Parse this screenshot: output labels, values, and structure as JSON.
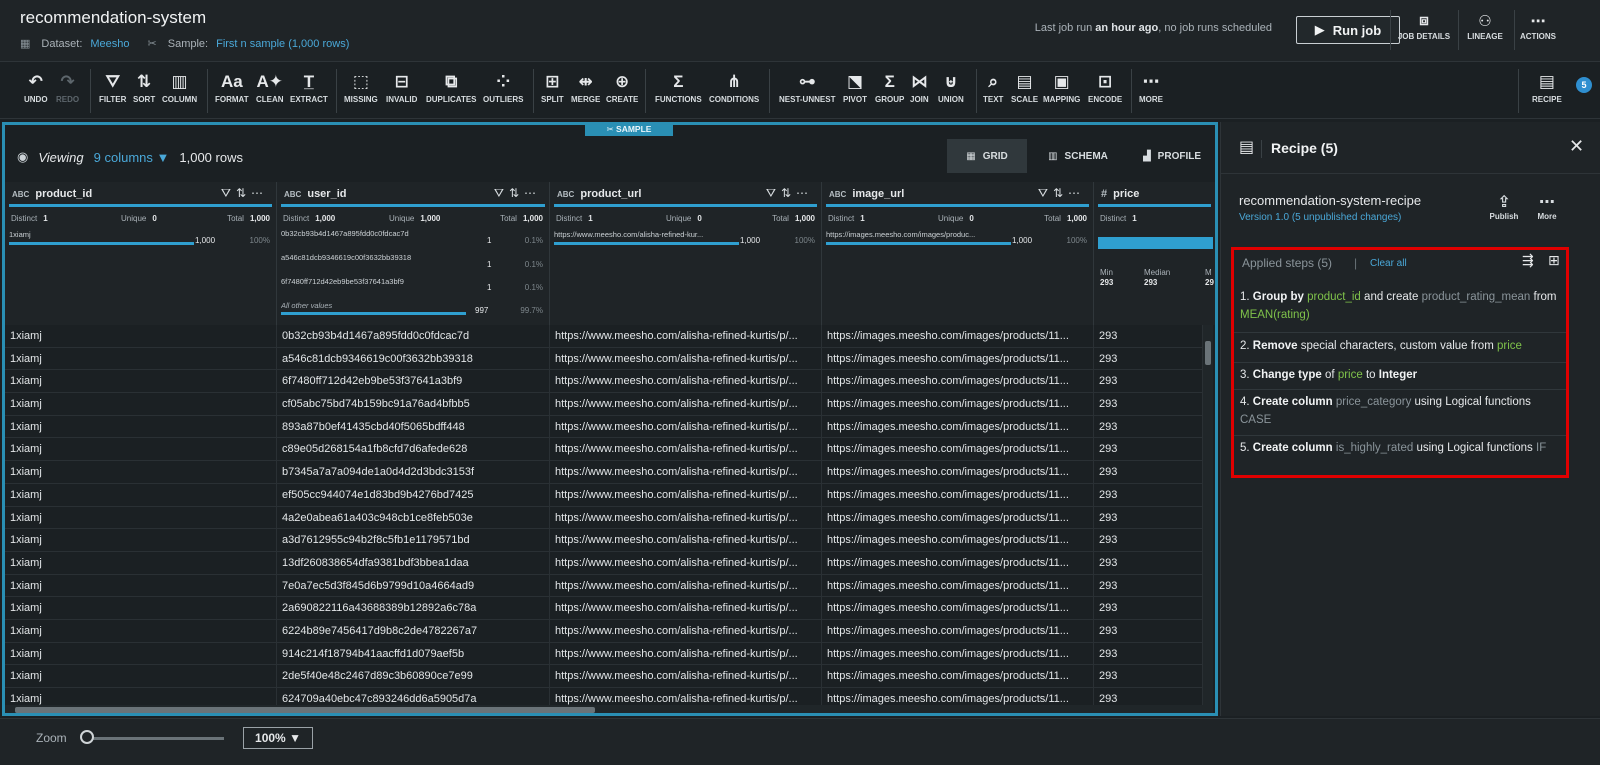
{
  "header": {
    "title": "recommendation-system",
    "dataset_label": "Dataset:",
    "dataset_name": "Meesho",
    "sample_label": "Sample:",
    "sample_name": "First n sample (1,000 rows)",
    "last_run_prefix": "Last job run",
    "last_run_time": "an hour ago",
    "last_run_suffix": ", no job runs scheduled",
    "run_job": "Run job",
    "actions": [
      {
        "icon": "play-square-icon",
        "label": "JOB DETAILS"
      },
      {
        "icon": "lineage-icon",
        "label": "LINEAGE"
      },
      {
        "icon": "more-icon",
        "label": "ACTIONS"
      }
    ]
  },
  "toolbar": {
    "undo": "UNDO",
    "redo": "REDO",
    "filter": "FILTER",
    "sort": "SORT",
    "column": "COLUMN",
    "format": "FORMAT",
    "clean": "CLEAN",
    "extract": "EXTRACT",
    "missing": "MISSING",
    "invalid": "INVALID",
    "duplicates": "DUPLICATES",
    "outliers": "OUTLIERS",
    "split": "SPLIT",
    "merge": "MERGE",
    "create": "CREATE",
    "functions": "FUNCTIONS",
    "conditions": "CONDITIONS",
    "nest_unnest": "NEST-UNNEST",
    "pivot": "PIVOT",
    "group": "GROUP",
    "join": "JOIN",
    "union": "UNION",
    "text": "TEXT",
    "scale": "SCALE",
    "mapping": "MAPPING",
    "encode": "ENCODE",
    "more": "MORE",
    "recipe": "RECIPE",
    "recipe_count": "5"
  },
  "grid": {
    "sample_tag": "SAMPLE",
    "viewing": "Viewing",
    "columns_count": "9 columns",
    "rows_count": "1,000 rows",
    "tabs": {
      "grid": "GRID",
      "schema": "SCHEMA",
      "profile": "PROFILE"
    },
    "stats_labels": {
      "distinct": "Distinct",
      "unique": "Unique",
      "total": "Total",
      "min": "Min",
      "median": "Median",
      "max": "M"
    },
    "columns": [
      {
        "type": "ABC",
        "name": "product_id",
        "distinct": "1",
        "unique": "0",
        "total": "1,000",
        "values": [
          {
            "v": "1xiamj",
            "count": "1,000",
            "pct": "100%"
          }
        ]
      },
      {
        "type": "ABC",
        "name": "user_id",
        "distinct": "1,000",
        "unique": "1,000",
        "total": "1,000",
        "values": [
          {
            "v": "0b32cb93b4d1467a895fdd0c0fdcac7d",
            "count": "1",
            "pct": "0.1%"
          },
          {
            "v": "a546c81dcb9346619c00f3632bb39318",
            "count": "1",
            "pct": "0.1%"
          },
          {
            "v": "6f7480ff712d42eb9be53f37641a3bf9",
            "count": "1",
            "pct": "0.1%"
          },
          {
            "v": "All other values",
            "count": "997",
            "pct": "99.7%"
          }
        ]
      },
      {
        "type": "ABC",
        "name": "product_url",
        "distinct": "1",
        "unique": "0",
        "total": "1,000",
        "values": [
          {
            "v": "https://www.meesho.com/alisha-refined-kur...",
            "count": "1,000",
            "pct": "100%"
          }
        ]
      },
      {
        "type": "ABC",
        "name": "image_url",
        "distinct": "1",
        "unique": "0",
        "total": "1,000",
        "values": [
          {
            "v": "https://images.meesho.com/images/produc...",
            "count": "1,000",
            "pct": "100%"
          }
        ]
      },
      {
        "type": "#",
        "name": "price",
        "distinct": "1",
        "min": "293",
        "median": "293",
        "max": "29"
      }
    ],
    "rows": [
      [
        "1xiamj",
        "0b32cb93b4d1467a895fdd0c0fdcac7d",
        "https://www.meesho.com/alisha-refined-kurtis/p/...",
        "https://images.meesho.com/images/products/11...",
        "293"
      ],
      [
        "1xiamj",
        "a546c81dcb9346619c00f3632bb39318",
        "https://www.meesho.com/alisha-refined-kurtis/p/...",
        "https://images.meesho.com/images/products/11...",
        "293"
      ],
      [
        "1xiamj",
        "6f7480ff712d42eb9be53f37641a3bf9",
        "https://www.meesho.com/alisha-refined-kurtis/p/...",
        "https://images.meesho.com/images/products/11...",
        "293"
      ],
      [
        "1xiamj",
        "cf05abc75bd74b159bc91a76ad4bfbb5",
        "https://www.meesho.com/alisha-refined-kurtis/p/...",
        "https://images.meesho.com/images/products/11...",
        "293"
      ],
      [
        "1xiamj",
        "893a87b0ef41435cbd40f5065bdff448",
        "https://www.meesho.com/alisha-refined-kurtis/p/...",
        "https://images.meesho.com/images/products/11...",
        "293"
      ],
      [
        "1xiamj",
        "c89e05d268154a1fb8cfd7d6afede628",
        "https://www.meesho.com/alisha-refined-kurtis/p/...",
        "https://images.meesho.com/images/products/11...",
        "293"
      ],
      [
        "1xiamj",
        "b7345a7a7a094de1a0d4d2d3bdc3153f",
        "https://www.meesho.com/alisha-refined-kurtis/p/...",
        "https://images.meesho.com/images/products/11...",
        "293"
      ],
      [
        "1xiamj",
        "ef505cc944074e1d83bd9b4276bd7425",
        "https://www.meesho.com/alisha-refined-kurtis/p/...",
        "https://images.meesho.com/images/products/11...",
        "293"
      ],
      [
        "1xiamj",
        "4a2e0abea61a403c948cb1ce8feb503e",
        "https://www.meesho.com/alisha-refined-kurtis/p/...",
        "https://images.meesho.com/images/products/11...",
        "293"
      ],
      [
        "1xiamj",
        "a3d7612955c94b2f8c5fb1e1179571bd",
        "https://www.meesho.com/alisha-refined-kurtis/p/...",
        "https://images.meesho.com/images/products/11...",
        "293"
      ],
      [
        "1xiamj",
        "13df260838654dfa9381bdf3bbea1daa",
        "https://www.meesho.com/alisha-refined-kurtis/p/...",
        "https://images.meesho.com/images/products/11...",
        "293"
      ],
      [
        "1xiamj",
        "7e0a7ec5d3f845d6b9799d10a4664ad9",
        "https://www.meesho.com/alisha-refined-kurtis/p/...",
        "https://images.meesho.com/images/products/11...",
        "293"
      ],
      [
        "1xiamj",
        "2a690822116a43688389b12892a6c78a",
        "https://www.meesho.com/alisha-refined-kurtis/p/...",
        "https://images.meesho.com/images/products/11...",
        "293"
      ],
      [
        "1xiamj",
        "6224b89e7456417d9b8c2de4782267a7",
        "https://www.meesho.com/alisha-refined-kurtis/p/...",
        "https://images.meesho.com/images/products/11...",
        "293"
      ],
      [
        "1xiamj",
        "914c214f18794b41aacffd1d079aef5b",
        "https://www.meesho.com/alisha-refined-kurtis/p/...",
        "https://images.meesho.com/images/products/11...",
        "293"
      ],
      [
        "1xiamj",
        "2de5f40e48c2467d89c3b60890ce7e99",
        "https://www.meesho.com/alisha-refined-kurtis/p/...",
        "https://images.meesho.com/images/products/11...",
        "293"
      ],
      [
        "1xiamj",
        "624709a40ebc47c893246dd6a5905d7a",
        "https://www.meesho.com/alisha-refined-kurtis/p/...",
        "https://images.meesho.com/images/products/11...",
        "293"
      ]
    ]
  },
  "recipe": {
    "title": "Recipe (5)",
    "name": "recommendation-system-recipe",
    "version": "Version 1.0 (5 unpublished changes)",
    "publish": "Publish",
    "more": "More",
    "applied_steps": "Applied steps (5)",
    "clear_all": "Clear all",
    "steps": [
      {
        "n": "1.",
        "verb": "Group by",
        "p1": "product_id",
        "t1": "and create",
        "m1": "product_rating_mean",
        "t2": "from",
        "p2": "MEAN(rating)"
      },
      {
        "n": "2.",
        "verb": "Remove",
        "t1": "special characters, custom value from",
        "p1": "price"
      },
      {
        "n": "3.",
        "verb": "Change type",
        "t1": "of",
        "p1": "price",
        "t2": "to",
        "b2": "Integer"
      },
      {
        "n": "4.",
        "verb": "Create column",
        "m1": "price_category",
        "t1": "using Logical functions",
        "m2": "CASE"
      },
      {
        "n": "5.",
        "verb": "Create column",
        "m1": "is_highly_rated",
        "t1": "using Logical functions",
        "m2": "IF"
      }
    ]
  },
  "footer": {
    "zoom_label": "Zoom",
    "zoom_value": "100%",
    "zoom_level_pct": 0
  }
}
